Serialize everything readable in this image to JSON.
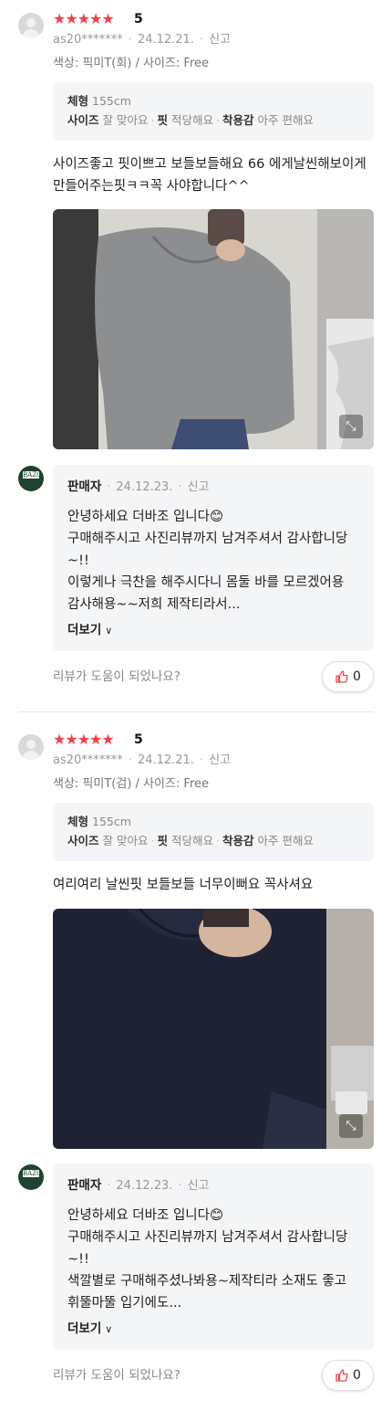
{
  "reviews": [
    {
      "rating_stars": "★★★★★",
      "rating": "5",
      "user": "as20*******",
      "date": "24.12.21.",
      "report": "신고",
      "option": "색상: 픽미T(회) / 사이즈: Free",
      "body_label": "체형",
      "body_value": "155cm",
      "size_label": "사이즈",
      "size_value": "잘 맞아요",
      "fit_label": "핏",
      "fit_value": "적당해요",
      "comfort_label": "착용감",
      "comfort_value": "아주 편해요",
      "text": "사이즈좋고 핏이쁘고 보들보들해요 66 에게날씬해보이게 만들어주는핏ㅋㅋ꼭 사야합니다^^",
      "photo_icon": "expand-icon",
      "reply": {
        "logo_text": "BAZO",
        "seller": "판매자",
        "date": "24.12.23.",
        "report": "신고",
        "text": "안녕하세요 더바조 입니다😊\n구매해주시고 사진리뷰까지 남겨주셔서 감사합니당~!!\n이렇게나 극찬을 해주시다니 몸둘 바를 모르겠어용 감사해용~~저희 제작티라서...",
        "more": "더보기"
      },
      "helpful_question": "리뷰가 도움이 되었나요?",
      "likes": "0",
      "photo_colors": {
        "shirt": "#8d8e90",
        "bg": "#d8d6d0"
      }
    },
    {
      "rating_stars": "★★★★★",
      "rating": "5",
      "user": "as20*******",
      "date": "24.12.21.",
      "report": "신고",
      "option": "색상: 픽미T(검) / 사이즈: Free",
      "body_label": "체형",
      "body_value": "155cm",
      "size_label": "사이즈",
      "size_value": "잘 맞아요",
      "fit_label": "핏",
      "fit_value": "적당해요",
      "comfort_label": "착용감",
      "comfort_value": "아주 편해요",
      "text": "여리여리 날씬핏 보들보들 너무이뻐요 꼭사셔요",
      "photo_icon": "expand-icon",
      "reply": {
        "logo_text": "BAZO",
        "seller": "판매자",
        "date": "24.12.23.",
        "report": "신고",
        "text": "안녕하세요 더바조 입니다😊\n구매해주시고 사진리뷰까지 남겨주셔서 감사합니당~!!\n색깔별로 구매해주셨나봐용~제작티라 소재도 좋고 휘뚤마뚤 입기에도...",
        "more": "더보기"
      },
      "helpful_question": "리뷰가 도움이 되었나요?",
      "likes": "0",
      "photo_colors": {
        "shirt": "#1e2233",
        "bg": "#cfcac4"
      }
    }
  ],
  "colors": {
    "star": "#f2404a",
    "like_icon": "#e8484f",
    "seller_logo": "#1f4330"
  }
}
